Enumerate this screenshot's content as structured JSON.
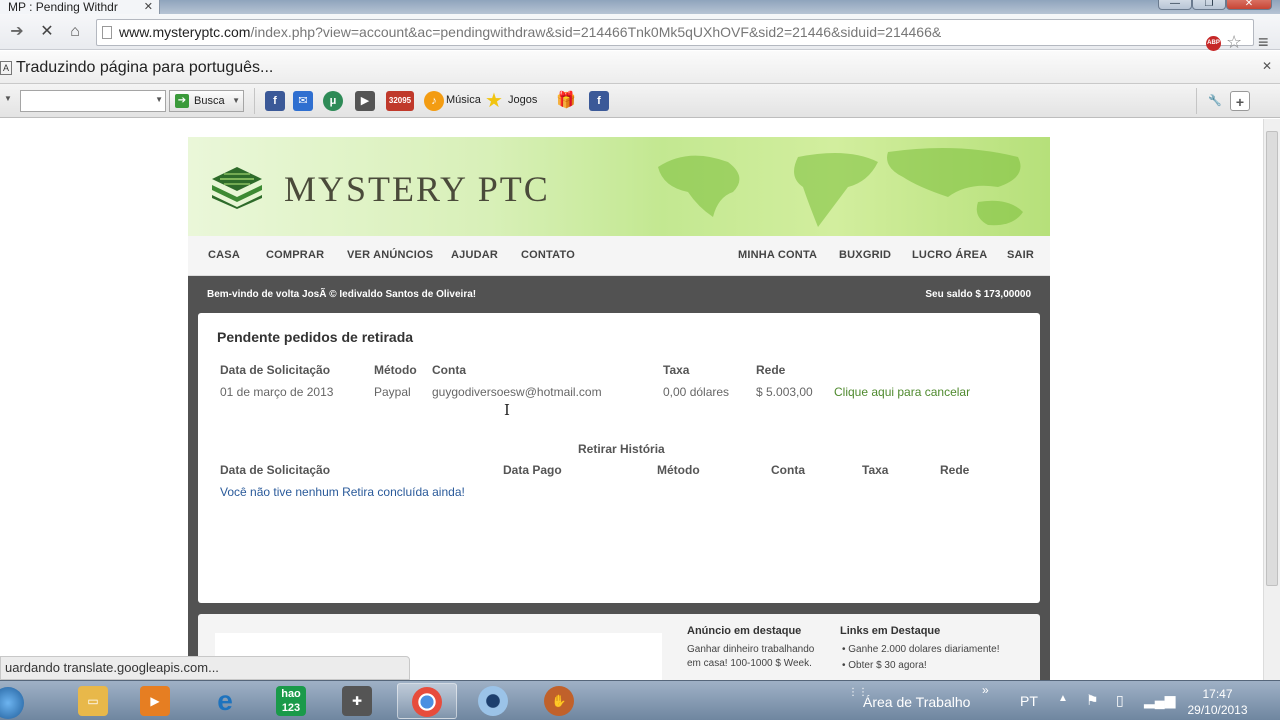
{
  "browser": {
    "tab_title": "MP : Pending Withdr",
    "url_host": "www.mysteryptc.com",
    "url_path": "/index.php?view=account&ac=pendingwithdraw&sid=214466Tnk0Mk5qUXhOVF&sid2=21446&siduid=214466&",
    "translate_message": "Traduzindo página para português...",
    "status_text": "uardando translate.googleapis.com..."
  },
  "bookmarks": {
    "search_button": "Busca",
    "musica": "Música",
    "jogos": "Jogos",
    "counter_badge": "32095"
  },
  "site": {
    "logo_text": "MYSTERY PTC",
    "nav_left": [
      "CASA",
      "COMPRAR",
      "VER ANÚNCIOS",
      "AJUDAR",
      "CONTATO"
    ],
    "nav_right": [
      "MINHA CONTA",
      "BUXGRID",
      "LUCRO ÁREA",
      "SAIR"
    ],
    "welcome": "Bem-vindo de volta JosÃ © Iedivaldo Santos de Oliveira!",
    "balance": "Seu saldo $ 173,00000"
  },
  "pending": {
    "title": "Pendente pedidos de retirada",
    "headers": [
      "Data de Solicitação",
      "Método",
      "Conta",
      "Taxa",
      "Rede"
    ],
    "rows": [
      {
        "date": "01 de março de 2013",
        "method": "Paypal",
        "account": "guygodiversoesw@hotmail.com",
        "fee": "0,00 dólares",
        "net": "$ 5.003,00",
        "action": "Clique aqui para cancelar"
      }
    ]
  },
  "history": {
    "title": "Retirar História",
    "headers": [
      "Data de Solicitação",
      "Data Pago",
      "Método",
      "Conta",
      "Taxa",
      "Rede"
    ],
    "empty_message": "Você não tive nenhum Retira concluída ainda!"
  },
  "footer_panel": {
    "featured_ad_title": "Anúncio em destaque",
    "featured_ad_text": "Ganhar dinheiro trabalhando em casa! 100-1000 $ Week.",
    "featured_links_title": "Links em Destaque",
    "featured_links": [
      "Ganhe 2.000 dolares diariamente!",
      "Obter $ 30 agora!"
    ]
  },
  "taskbar": {
    "desktop_label": "Área de Trabalho",
    "language": "PT",
    "time": "17:47",
    "date": "29/10/2013",
    "apps": [
      "explorer",
      "media-player",
      "internet-explorer",
      "hao123",
      "games",
      "chrome",
      "webcam",
      "baseball-glove"
    ]
  }
}
